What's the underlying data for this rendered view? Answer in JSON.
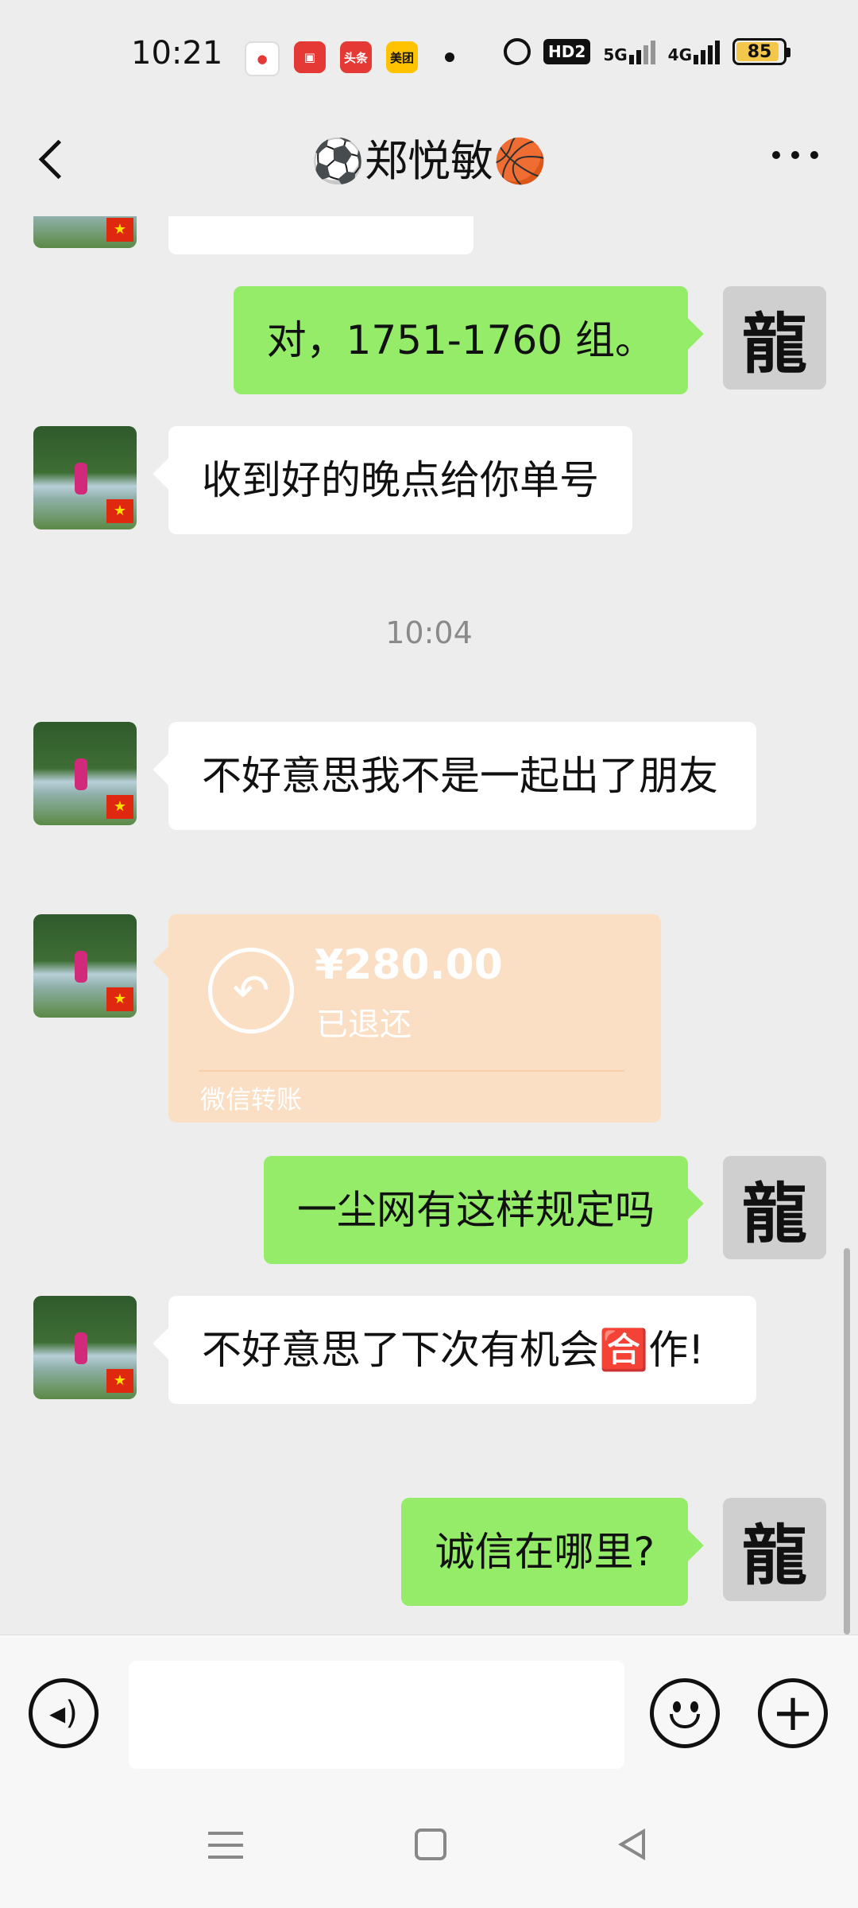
{
  "status_bar": {
    "time": "10:21",
    "app_icons": [
      {
        "icon": "map-pin-icon",
        "label": "",
        "color": "#e53935"
      },
      {
        "icon": "shopping-app-icon",
        "label": "",
        "color": "#e53935"
      },
      {
        "icon": "toutiao-icon",
        "label": "头条",
        "color": "#e53935"
      },
      {
        "icon": "meituan-icon",
        "label": "美团",
        "color": "#ffc300"
      }
    ],
    "hd_label": "HD2",
    "network_1": "5G",
    "network_2": "4G",
    "battery": "85"
  },
  "header": {
    "title": "⚽郑悦敏🏀"
  },
  "chat": {
    "messages": [
      {
        "side": "in",
        "text": ""
      },
      {
        "side": "out",
        "text": "对，1751-1760 组。"
      },
      {
        "side": "in",
        "text": "收到好的晚点给你单号"
      },
      {
        "timestamp": "10:04"
      },
      {
        "side": "in",
        "text": "不好意思我不是一起出了朋友"
      },
      {
        "side": "in",
        "type": "transfer",
        "amount": "¥280.00",
        "status": "已退还",
        "label": "微信转账"
      },
      {
        "side": "out",
        "text": "一尘网有这样规定吗"
      },
      {
        "side": "in",
        "text": "不好意思了下次有机会🈴作!"
      },
      {
        "side": "out",
        "text": "诚信在哪里?"
      }
    ],
    "self_avatar_glyph": "龍",
    "contact_flag": "★"
  },
  "input_bar": {
    "placeholder": ""
  },
  "colors": {
    "outgoing_bubble": "#95ec69",
    "incoming_bubble": "#ffffff",
    "transfer_bubble": "#fbdfc4",
    "background": "#ededed"
  }
}
